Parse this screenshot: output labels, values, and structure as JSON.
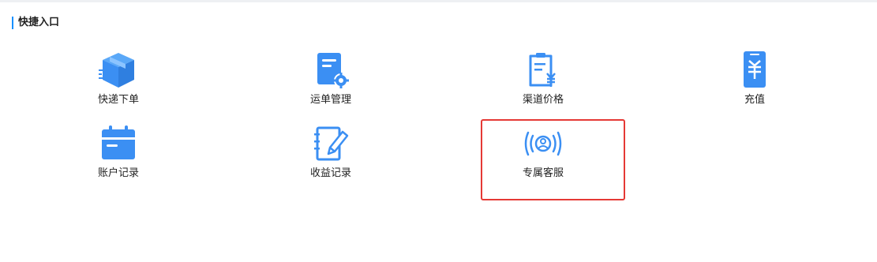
{
  "section": {
    "title": "快捷入口"
  },
  "tiles": [
    {
      "label": "快递下单"
    },
    {
      "label": "运单管理"
    },
    {
      "label": "渠道价格"
    },
    {
      "label": "充值"
    },
    {
      "label": "账户记录"
    },
    {
      "label": "收益记录"
    },
    {
      "label": "专属客服"
    }
  ],
  "icon_names": [
    "box-icon",
    "waybill-settings-icon",
    "price-list-icon",
    "phone-recharge-icon",
    "calendar-icon",
    "notebook-pen-icon",
    "headset-service-icon"
  ],
  "colors": {
    "accent": "#1890ff",
    "icon": "#3b8ff3",
    "highlight": "#e53935"
  }
}
